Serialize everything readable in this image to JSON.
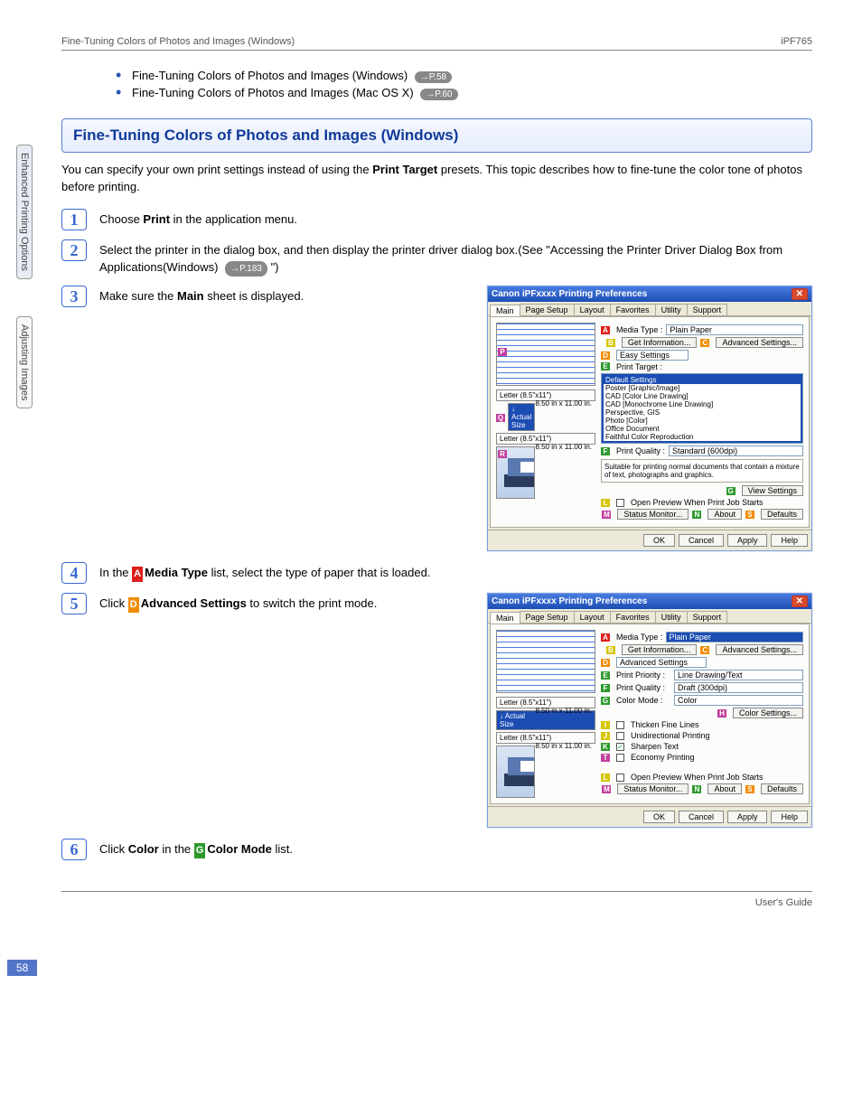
{
  "header": {
    "left": "Fine-Tuning Colors of Photos and Images (Windows)",
    "right": "iPF765"
  },
  "sideTabs": {
    "t1": "Enhanced Printing Options",
    "t2": "Adjusting Images"
  },
  "bullets": {
    "b1": "Fine-Tuning Colors of Photos and Images (Windows)",
    "b1ref": "→P.58",
    "b2": "Fine-Tuning Colors of Photos and Images (Mac OS X)",
    "b2ref": "→P.60"
  },
  "sectionTitle": "Fine-Tuning Colors of Photos and Images (Windows)",
  "intro1": "You can specify your own print settings instead of using the ",
  "intro2": "Print Target",
  "intro3": " presets. This topic describes how to fine-tune the color tone of photos before printing.",
  "steps": {
    "s1a": "Choose ",
    "s1b": "Print",
    "s1c": " in the application menu.",
    "s2a": "Select the printer in the dialog box, and then display the printer driver dialog box.(See \"Accessing the Printer Driver Dialog Box from Applications(Windows) ",
    "s2ref": "→P.183",
    "s2b": " \")",
    "s3a": "Make sure the ",
    "s3b": "Main",
    "s3c": " sheet is displayed.",
    "s4a": "In the ",
    "s4b": "Media Type",
    "s4c": " list, select the type of paper that is loaded.",
    "s5a": "Click ",
    "s5b": "Advanced Settings",
    "s5c": " to switch the print mode.",
    "s6a": "Click ",
    "s6b": "Color",
    "s6c": " in the ",
    "s6d": "Color Mode",
    "s6e": " list."
  },
  "stepLetters": {
    "s4": "A",
    "s5": "D",
    "s6a": "G"
  },
  "stepNums": {
    "n1": "1",
    "n2": "2",
    "n3": "3",
    "n4": "4",
    "n5": "5",
    "n6": "6"
  },
  "dlg": {
    "title": "Canon iPFxxxx Printing Preferences",
    "tabs": [
      "Main",
      "Page Setup",
      "Layout",
      "Favorites",
      "Utility",
      "Support"
    ],
    "mediaType": "Media Type :",
    "mediaVal": "Plain Paper",
    "getInfo": "Get Information...",
    "advSet": "Advanced Settings...",
    "easy": "Easy Settings",
    "printTarget": "Print Target :",
    "targets": [
      "Default Settings",
      "Poster [Graphic/Image]",
      "CAD [Color Line Drawing]",
      "CAD [Monochrome Line Drawing]",
      "Perspective, GIS",
      "Photo [Color]",
      "Office Document",
      "Faithful Color Reproduction"
    ],
    "printQuality": "Print Quality :",
    "qualityVal": "Standard (600dpi)",
    "note": "Suitable for printing normal documents that contain a mixture of text, photographs and graphics.",
    "viewSettings": "View Settings",
    "openPreview": "Open Preview When Print Job Starts",
    "statusMon": "Status Monitor...",
    "about": "About",
    "defaults": "Defaults",
    "ok": "OK",
    "cancel": "Cancel",
    "apply": "Apply",
    "help": "Help",
    "sz1": "Letter (8.5\"x11\")",
    "sz1b": "8.50 in x 11.00 in.",
    "actual": "Actual Size",
    "sz2": "Letter (8.5\"x11\")",
    "sz2b": "8.50 in x 11.00 in."
  },
  "dlg2": {
    "advSettings": "Advanced Settings",
    "printPriority": "Print Priority :",
    "ppVal": "Line Drawing/Text",
    "printQuality": "Print Quality :",
    "pqVal": "Draft (300dpi)",
    "colorMode": "Color Mode :",
    "cmVal": "Color",
    "colorSettings": "Color Settings...",
    "thicken": "Thicken Fine Lines",
    "uni": "Unidirectional Printing",
    "sharpen": "Sharpen Text",
    "econ": "Economy Printing"
  },
  "pageNumber": "58",
  "footer": "User's Guide"
}
